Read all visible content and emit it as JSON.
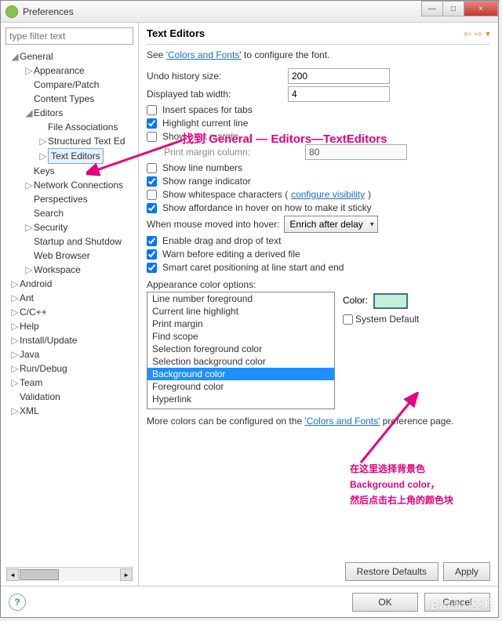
{
  "title": "Preferences",
  "winbtns": {
    "min": "—",
    "max": "□",
    "close": "×"
  },
  "filter_placeholder": "type filter text",
  "tree": {
    "general": "General",
    "appearance": "Appearance",
    "compare": "Compare/Patch",
    "contenttypes": "Content Types",
    "editors": "Editors",
    "fileassoc": "File Associations",
    "structured": "Structured Text Ed",
    "texteditors": "Text Editors",
    "keys": "Keys",
    "network": "Network Connections",
    "perspectives": "Perspectives",
    "search": "Search",
    "security": "Security",
    "startup": "Startup and Shutdow",
    "webbrowser": "Web Browser",
    "workspace": "Workspace",
    "android": "Android",
    "ant": "Ant",
    "cpp": "C/C++",
    "help": "Help",
    "install": "Install/Update",
    "java": "Java",
    "rundebug": "Run/Debug",
    "team": "Team",
    "validation": "Validation",
    "xml": "XML"
  },
  "header": "Text Editors",
  "intro_pre": "See ",
  "intro_link": "'Colors and Fonts'",
  "intro_post": " to configure the font.",
  "undo_label": "Undo history size:",
  "undo_value": "200",
  "tab_label": "Displayed tab width:",
  "tab_value": "4",
  "chk_insertspaces": "Insert spaces for tabs",
  "chk_highlightline": "Highlight current line",
  "chk_showprintmargin": "Show print margin",
  "printmargin_label": "Print margin column:",
  "printmargin_value": "80",
  "chk_linenums": "Show line numbers",
  "chk_range": "Show range indicator",
  "chk_whitespace_pre": "Show whitespace characters (",
  "chk_whitespace_link": "configure visibility",
  "chk_whitespace_post": ")",
  "chk_affordance": "Show affordance in hover on how to make it sticky",
  "hover_label": "When mouse moved into hover:",
  "hover_value": "Enrich after delay",
  "chk_drag": "Enable drag and drop of text",
  "chk_warn": "Warn before editing a derived file",
  "chk_smartcaret": "Smart caret positioning at line start and end",
  "colors_label": "Appearance color options:",
  "color_items": [
    "Line number foreground",
    "Current line highlight",
    "Print margin",
    "Find scope",
    "Selection foreground color",
    "Selection background color",
    "Background color",
    "Foreground color",
    "Hyperlink"
  ],
  "color_lbl": "Color:",
  "sysdef": "System Default",
  "footnote_pre": "More colors can be configured on the ",
  "footnote_link": "'Colors and Fonts'",
  "footnote_post": " preference page.",
  "btn_restore": "Restore Defaults",
  "btn_apply": "Apply",
  "btn_ok": "OK",
  "btn_cancel": "Cancel",
  "anno1": "找到 General — Editors—TextEditors",
  "anno2a": "在这里选择背景色",
  "anno2b": "Background color，",
  "anno2c": "然后点击右上角的颜色块",
  "watermark": "Baidu 经验"
}
